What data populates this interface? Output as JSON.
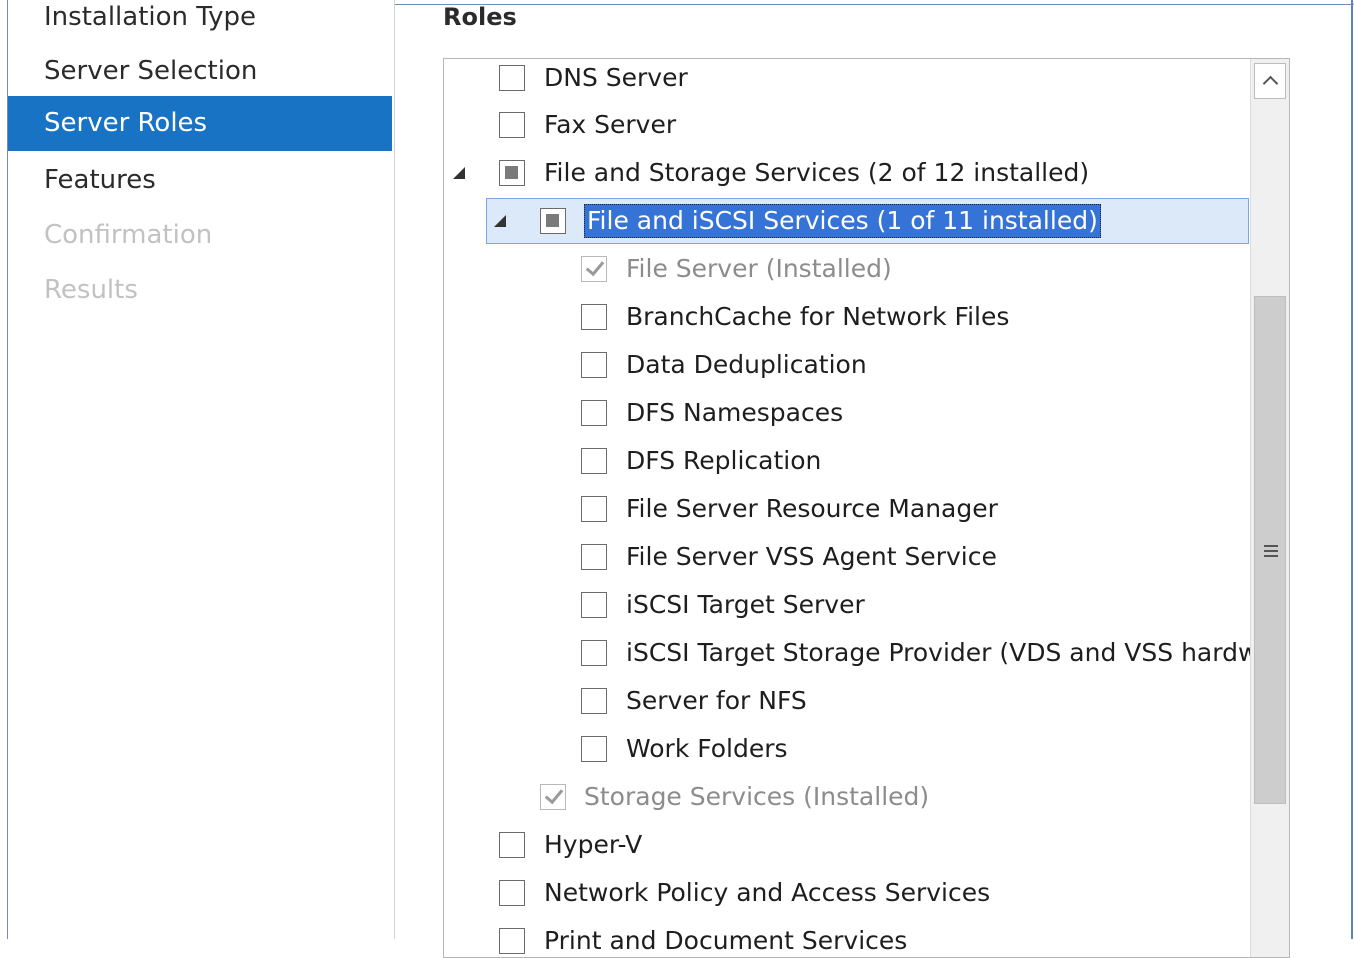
{
  "nav": {
    "items": [
      {
        "label": "Installation Type",
        "state": "normal"
      },
      {
        "label": "Server Selection",
        "state": "normal"
      },
      {
        "label": "Server Roles",
        "state": "selected"
      },
      {
        "label": "Features",
        "state": "normal"
      },
      {
        "label": "Confirmation",
        "state": "disabled"
      },
      {
        "label": "Results",
        "state": "disabled"
      }
    ]
  },
  "roles": {
    "heading": "Roles",
    "items": [
      {
        "label": "DNS Server",
        "checkbox": "unchecked"
      },
      {
        "label": "Fax Server",
        "checkbox": "unchecked"
      },
      {
        "label": "File and Storage Services (2 of 12 installed)",
        "checkbox": "partial",
        "expanded": true
      },
      {
        "label": "File and iSCSI Services (1 of 11 installed)",
        "checkbox": "partial",
        "expanded": true,
        "selected": true
      },
      {
        "label": "File Server (Installed)",
        "checkbox": "checked-disabled"
      },
      {
        "label": "BranchCache for Network Files",
        "checkbox": "unchecked"
      },
      {
        "label": "Data Deduplication",
        "checkbox": "unchecked"
      },
      {
        "label": "DFS Namespaces",
        "checkbox": "unchecked"
      },
      {
        "label": "DFS Replication",
        "checkbox": "unchecked"
      },
      {
        "label": "File Server Resource Manager",
        "checkbox": "unchecked"
      },
      {
        "label": "File Server VSS Agent Service",
        "checkbox": "unchecked"
      },
      {
        "label": "iSCSI Target Server",
        "checkbox": "unchecked"
      },
      {
        "label": "iSCSI Target Storage Provider (VDS and VSS hardwa",
        "checkbox": "unchecked"
      },
      {
        "label": "Server for NFS",
        "checkbox": "unchecked"
      },
      {
        "label": "Work Folders",
        "checkbox": "unchecked"
      },
      {
        "label": "Storage Services (Installed)",
        "checkbox": "checked-disabled"
      },
      {
        "label": "Hyper-V",
        "checkbox": "unchecked"
      },
      {
        "label": "Network Policy and Access Services",
        "checkbox": "unchecked"
      },
      {
        "label": "Print and Document Services",
        "checkbox": "unchecked"
      }
    ]
  },
  "colors": {
    "accent": "#1873c5",
    "selection_highlight": "#3574d6"
  },
  "icons": {
    "expander": "expand-triangle-icon",
    "scroll_up": "chevron-up-icon",
    "grip": "scroll-grip-icon"
  }
}
